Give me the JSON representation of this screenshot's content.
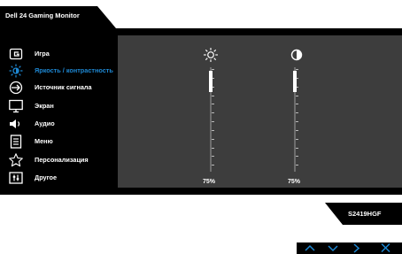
{
  "title": "Dell 24 Gaming Monitor",
  "model": "S2419HGF",
  "menu": [
    {
      "label": "Игра",
      "icon": "game-icon"
    },
    {
      "label": "Яркость / контрастность",
      "icon": "brightness-icon",
      "active": true
    },
    {
      "label": "Источник сигнала",
      "icon": "input-source-icon"
    },
    {
      "label": "Экран",
      "icon": "display-icon"
    },
    {
      "label": "Аудио",
      "icon": "audio-icon"
    },
    {
      "label": "Меню",
      "icon": "menu-icon"
    },
    {
      "label": "Персонализация",
      "icon": "star-icon"
    },
    {
      "label": "Другое",
      "icon": "other-icon"
    }
  ],
  "sliders": {
    "brightness": {
      "value": 75,
      "label": "75%",
      "icon": "sun-icon"
    },
    "contrast": {
      "value": 75,
      "label": "75%",
      "icon": "contrast-icon"
    }
  },
  "nav_buttons": [
    "up-arrow",
    "down-arrow",
    "right-arrow",
    "close-x"
  ],
  "colors": {
    "accent": "#1e88d3",
    "panel": "#000000",
    "content": "#3d3d3d"
  }
}
